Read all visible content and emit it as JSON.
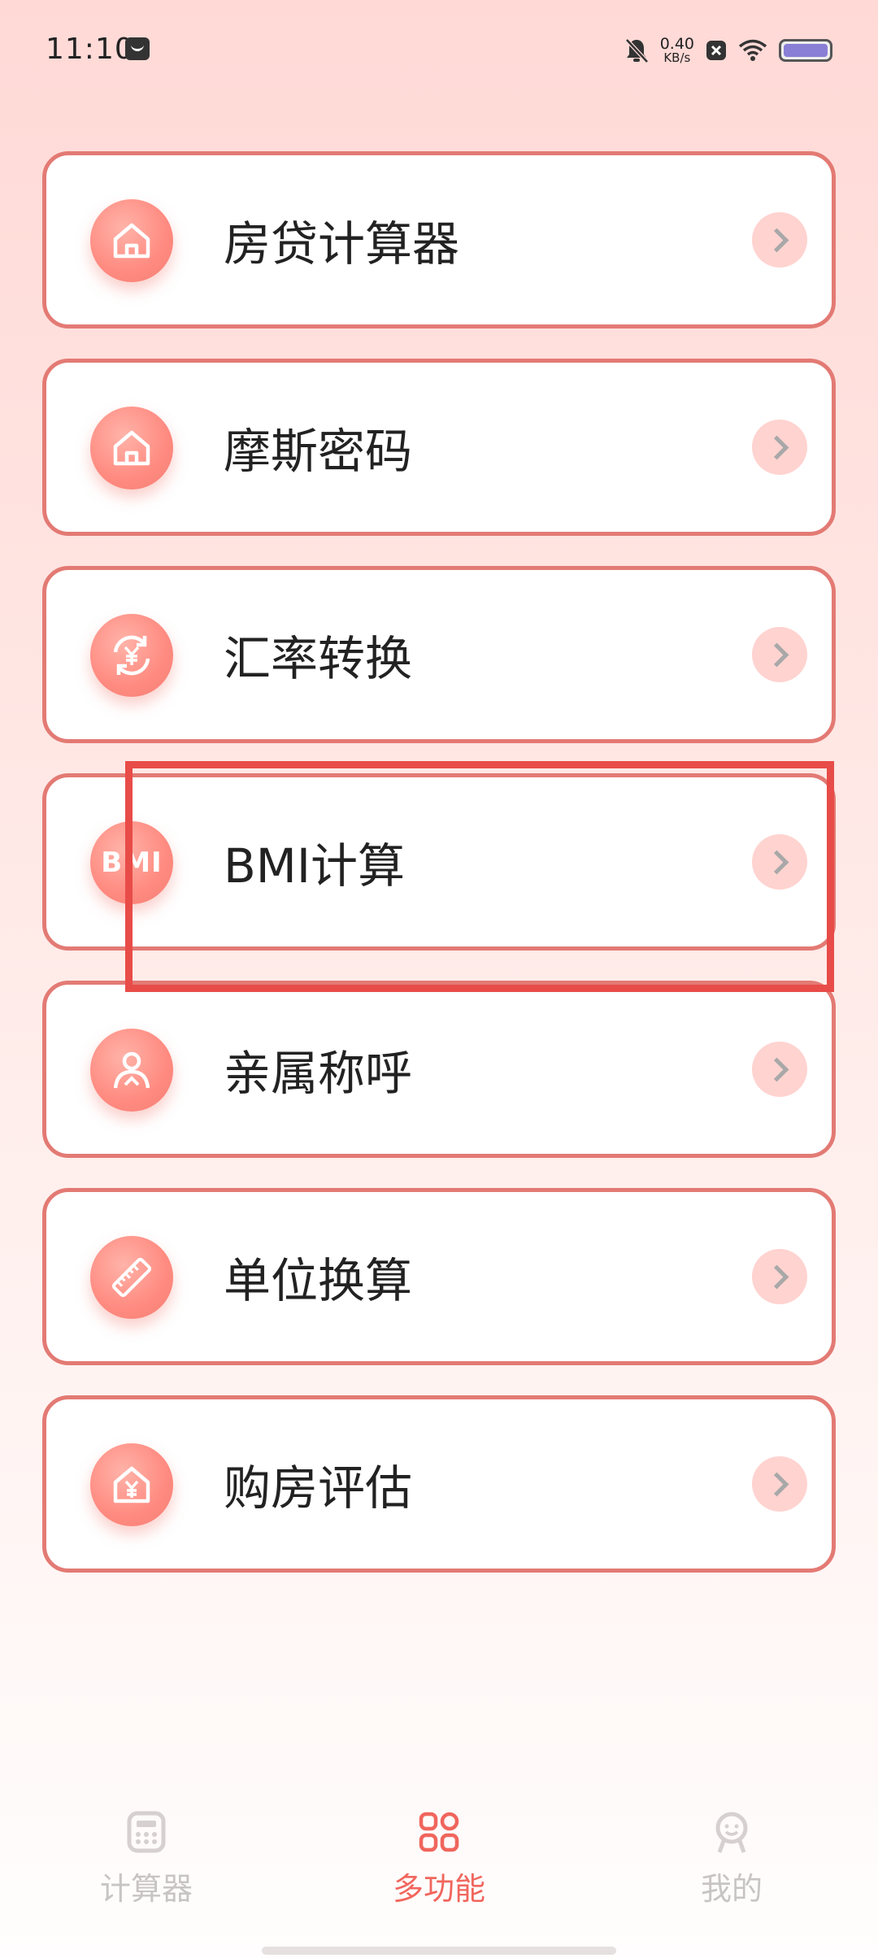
{
  "status_bar": {
    "time": "11:10",
    "net_speed_value": "0.40",
    "net_speed_unit": "KB/s",
    "icons": [
      "message-icon",
      "bell-off-icon",
      "x-box-icon",
      "wifi-icon",
      "battery-icon"
    ]
  },
  "menu": {
    "items": [
      {
        "label": "房贷计算器",
        "icon": "house-icon"
      },
      {
        "label": "摩斯密码",
        "icon": "house-icon"
      },
      {
        "label": "汇率转换",
        "icon": "currency-exchange-icon"
      },
      {
        "label": "BMI计算",
        "icon": "bmi-icon",
        "icon_text": "BMI"
      },
      {
        "label": "亲属称呼",
        "icon": "person-icon"
      },
      {
        "label": "单位换算",
        "icon": "ruler-icon"
      },
      {
        "label": "购房评估",
        "icon": "house-yen-icon"
      }
    ]
  },
  "bottom_nav": {
    "items": [
      {
        "label": "计算器",
        "icon": "calculator-icon",
        "active": false
      },
      {
        "label": "多功能",
        "icon": "grid-icon",
        "active": true
      },
      {
        "label": "我的",
        "icon": "profile-icon",
        "active": false
      }
    ]
  },
  "colors": {
    "accent": "#f0665d",
    "card_border": "#e37a74",
    "icon_bg": "#ff8a80",
    "chevron_bg": "#ffd3d0",
    "highlight": "#e84c48"
  }
}
